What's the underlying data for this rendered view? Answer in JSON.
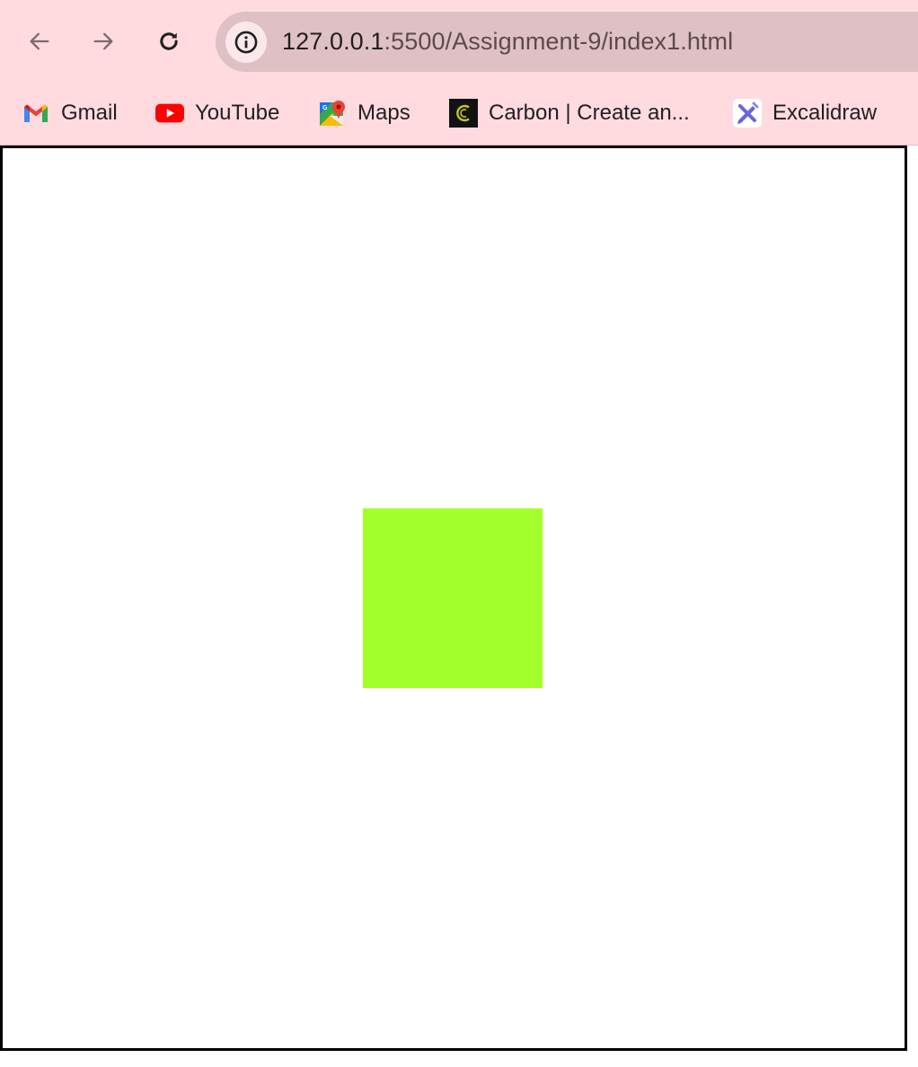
{
  "browser": {
    "url_host": "127.0.0.1",
    "url_rest": ":5500/Assignment-9/index1.html",
    "chrome_color": "#ffdbe0"
  },
  "nav": {
    "back_icon": "arrow-left-icon",
    "forward_icon": "arrow-right-icon",
    "reload_icon": "reload-icon",
    "info_icon": "info-icon"
  },
  "bookmarks": [
    {
      "label": "Gmail",
      "icon": "gmail-icon"
    },
    {
      "label": "YouTube",
      "icon": "youtube-icon"
    },
    {
      "label": "Maps",
      "icon": "maps-icon"
    },
    {
      "label": "Carbon | Create an...",
      "icon": "carbon-icon"
    },
    {
      "label": "Excalidraw",
      "icon": "excalidraw-icon"
    }
  ],
  "page": {
    "box_color": "#a3ff2a",
    "border_color": "#000000"
  }
}
